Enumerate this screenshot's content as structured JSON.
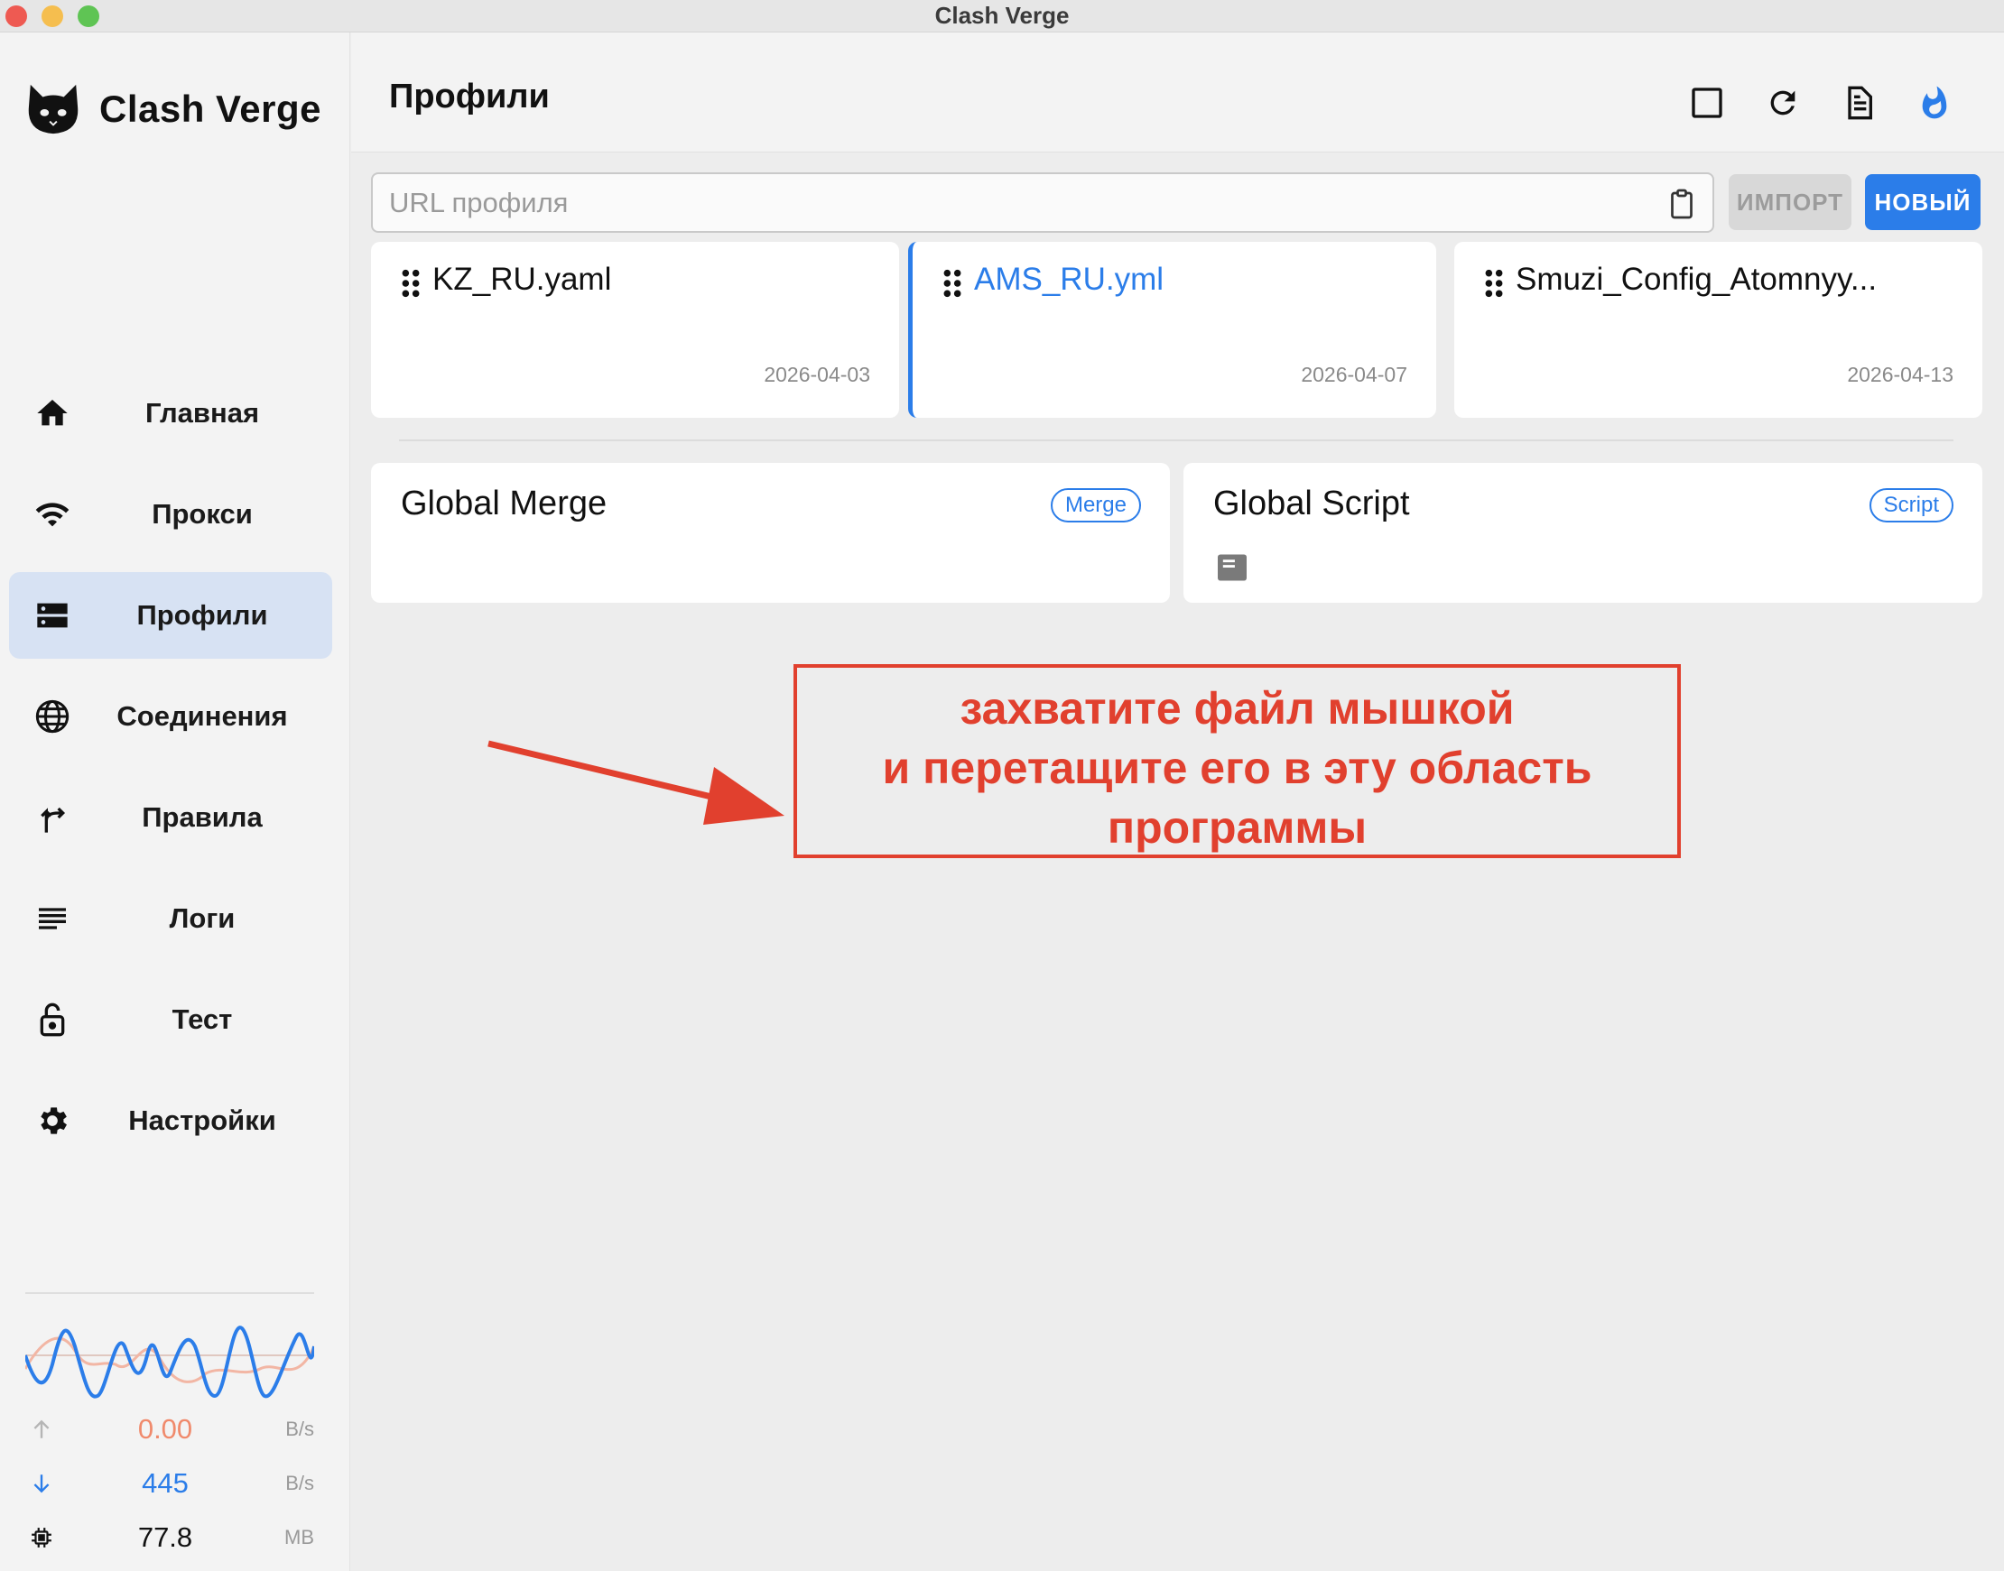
{
  "window": {
    "title": "Clash Verge"
  },
  "app": {
    "name": "Clash Verge"
  },
  "sidebar": {
    "items": [
      {
        "label": "Главная",
        "icon": "home-icon"
      },
      {
        "label": "Прокси",
        "icon": "wifi-icon"
      },
      {
        "label": "Профили",
        "icon": "storage-icon",
        "active": true
      },
      {
        "label": "Соединения",
        "icon": "globe-icon"
      },
      {
        "label": "Правила",
        "icon": "fork-icon"
      },
      {
        "label": "Логи",
        "icon": "list-icon"
      },
      {
        "label": "Тест",
        "icon": "lock-icon"
      },
      {
        "label": "Настройки",
        "icon": "gear-icon"
      }
    ],
    "traffic": {
      "upload": {
        "value": "0.00",
        "unit": "B/s"
      },
      "download": {
        "value": "445",
        "unit": "B/s"
      },
      "memory": {
        "value": "77.8",
        "unit": "MB"
      }
    }
  },
  "header": {
    "title": "Профили"
  },
  "toolbar": {
    "url_placeholder": "URL профиля",
    "url_value": "",
    "import_label": "ИМПОРТ",
    "new_label": "НОВЫЙ"
  },
  "profiles": [
    {
      "name": "KZ_RU.yaml",
      "date": "2026-04-03",
      "active": false
    },
    {
      "name": "AMS_RU.yml",
      "date": "2026-04-07",
      "active": true
    },
    {
      "name": "Smuzi_Config_Atomnyy...",
      "date": "2026-04-13",
      "active": false
    }
  ],
  "globals": [
    {
      "name": "Global Merge",
      "badge": "Merge"
    },
    {
      "name": "Global Script",
      "badge": "Script"
    }
  ],
  "annotation": {
    "lines": [
      "захватите файл мышкой",
      "и перетащите его в эту область",
      "программы"
    ]
  },
  "colors": {
    "accent": "#2b7de9",
    "annotation": "#e1402e",
    "upload": "#f08a6c"
  }
}
